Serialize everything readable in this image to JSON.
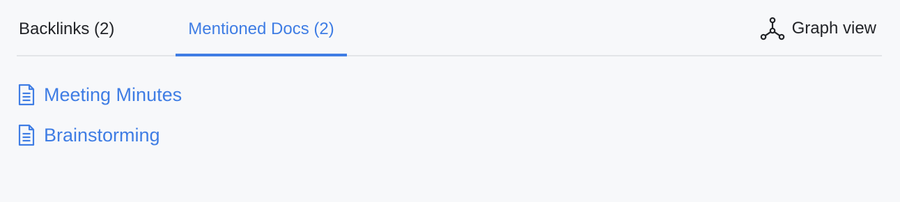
{
  "tabs": {
    "backlinks_label": "Backlinks (2)",
    "mentioned_label": "Mentioned Docs (2)",
    "active": "mentioned"
  },
  "graph_view": {
    "label": "Graph view",
    "icon": "graph-nodes-icon"
  },
  "mentioned_docs": [
    {
      "title": "Meeting Minutes",
      "icon": "document-icon"
    },
    {
      "title": "Brainstorming",
      "icon": "document-icon"
    }
  ],
  "colors": {
    "accent": "#3f7de4",
    "text": "#222428",
    "divider": "#e3e5e8",
    "background": "#f7f8fa"
  }
}
